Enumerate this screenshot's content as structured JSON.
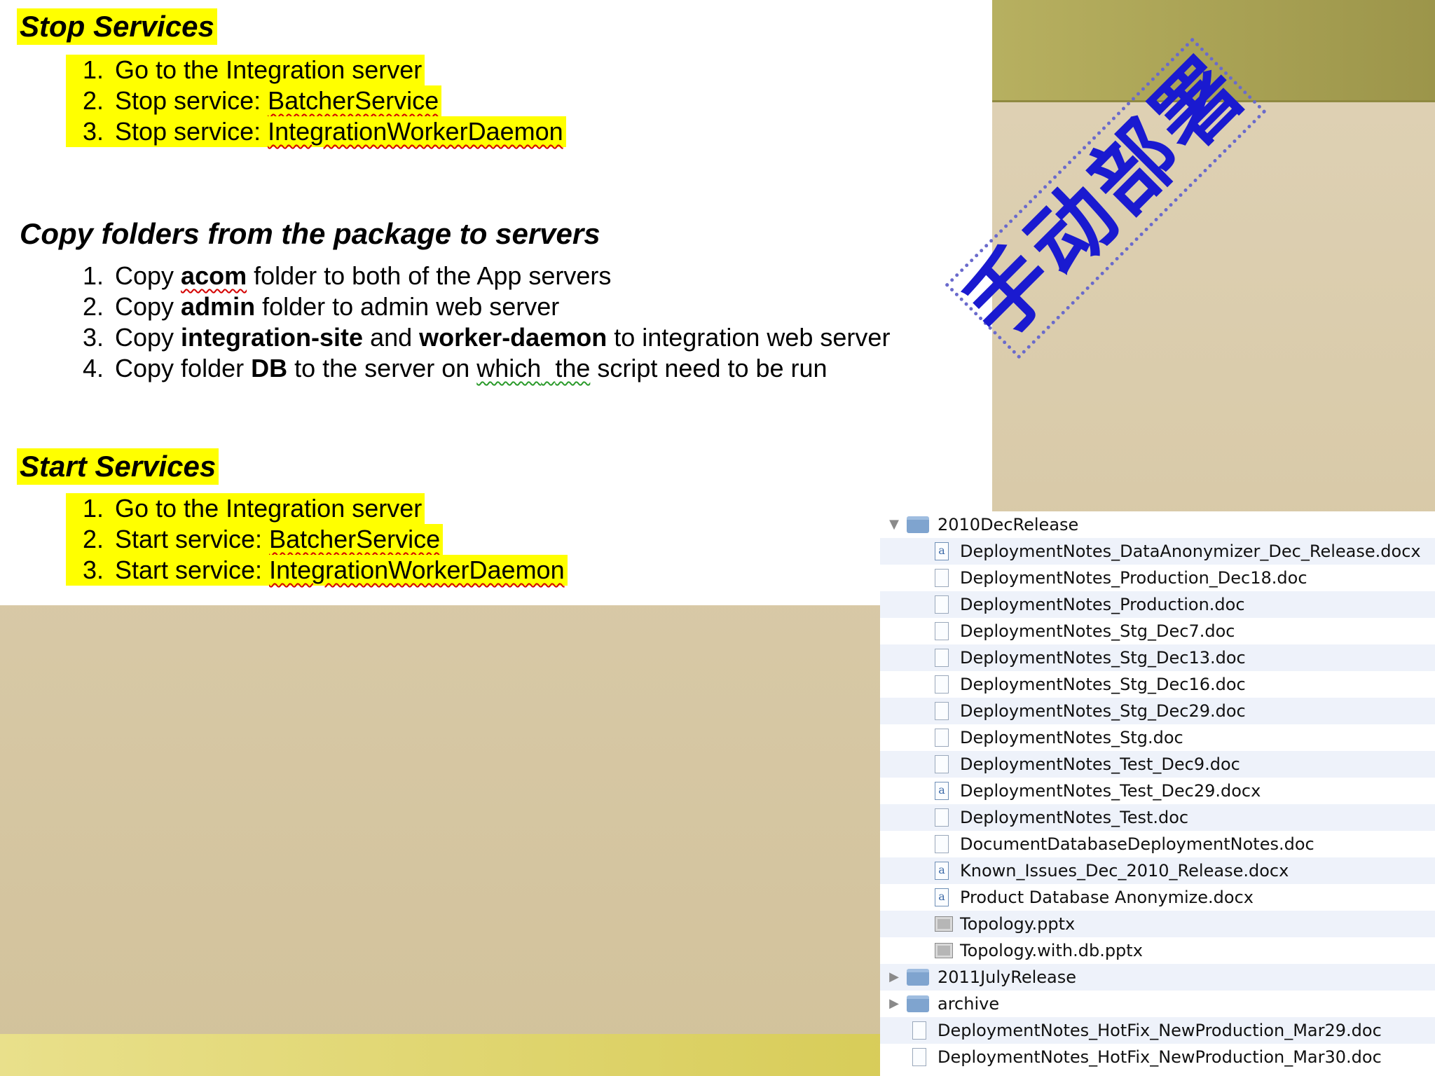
{
  "stop_section": {
    "title": "Stop Services",
    "items": [
      {
        "num": "1.",
        "text": "Go to the Integration server"
      },
      {
        "num": "2.",
        "prefix": "Stop service: ",
        "service": "BatcherService"
      },
      {
        "num": "3.",
        "prefix": "Stop service: ",
        "service": "IntegrationWorkerDaemon"
      }
    ]
  },
  "copy_section": {
    "title": "Copy folders from the package to servers",
    "items": [
      {
        "num": "1.",
        "parts": [
          "Copy ",
          "acom",
          " folder to both of the App servers"
        ]
      },
      {
        "num": "2.",
        "parts": [
          "Copy ",
          "admin",
          " folder to admin web server"
        ]
      },
      {
        "num": "3.",
        "parts": [
          "Copy ",
          "integration-site",
          " and ",
          "worker-daemon",
          " to integration web server"
        ]
      },
      {
        "num": "4.",
        "parts": [
          "Copy folder ",
          "DB",
          " to the server on ",
          "which",
          "  ",
          "the",
          " script need to be run"
        ]
      }
    ]
  },
  "start_section": {
    "title": "Start Services",
    "items": [
      {
        "num": "1.",
        "text": "Go to the Integration server"
      },
      {
        "num": "2.",
        "prefix": "Start service: ",
        "service": "BatcherService"
      },
      {
        "num": "3.",
        "prefix": "Start service: ",
        "service": "IntegrationWorkerDaemon"
      }
    ]
  },
  "stamp": {
    "text": "手动部署",
    "color": "#1a1ad0"
  },
  "finder": {
    "rows": [
      {
        "name": "2010DecRelease",
        "kind": "folder",
        "expanded": true
      },
      {
        "name": "DeploymentNotes_DataAnonymizer_Dec_Release.docx",
        "kind": "docx"
      },
      {
        "name": "DeploymentNotes_Production_Dec18.doc",
        "kind": "doc"
      },
      {
        "name": "DeploymentNotes_Production.doc",
        "kind": "doc"
      },
      {
        "name": "DeploymentNotes_Stg_Dec7.doc",
        "kind": "doc"
      },
      {
        "name": "DeploymentNotes_Stg_Dec13.doc",
        "kind": "doc"
      },
      {
        "name": "DeploymentNotes_Stg_Dec16.doc",
        "kind": "doc"
      },
      {
        "name": "DeploymentNotes_Stg_Dec29.doc",
        "kind": "doc"
      },
      {
        "name": "DeploymentNotes_Stg.doc",
        "kind": "doc"
      },
      {
        "name": "DeploymentNotes_Test_Dec9.doc",
        "kind": "doc"
      },
      {
        "name": "DeploymentNotes_Test_Dec29.docx",
        "kind": "docx"
      },
      {
        "name": "DeploymentNotes_Test.doc",
        "kind": "doc"
      },
      {
        "name": "DocumentDatabaseDeploymentNotes.doc",
        "kind": "doc"
      },
      {
        "name": "Known_Issues_Dec_2010_Release.docx",
        "kind": "docx"
      },
      {
        "name": "Product Database Anonymize.docx",
        "kind": "docx"
      },
      {
        "name": "Topology.pptx",
        "kind": "pptx"
      },
      {
        "name": "Topology.with.db.pptx",
        "kind": "pptx"
      },
      {
        "name": "2011JulyRelease",
        "kind": "folder",
        "expanded": false
      },
      {
        "name": "archive",
        "kind": "folder",
        "expanded": false
      },
      {
        "name": "DeploymentNotes_HotFix_NewProduction_Mar29.doc",
        "kind": "doc"
      },
      {
        "name": "DeploymentNotes_HotFix_NewProduction_Mar30.doc",
        "kind": "doc"
      }
    ],
    "docx_glyph": "a",
    "expanded_glyph": "▼",
    "collapsed_glyph": "▶",
    "alt_row_color": "#eef2fa"
  }
}
